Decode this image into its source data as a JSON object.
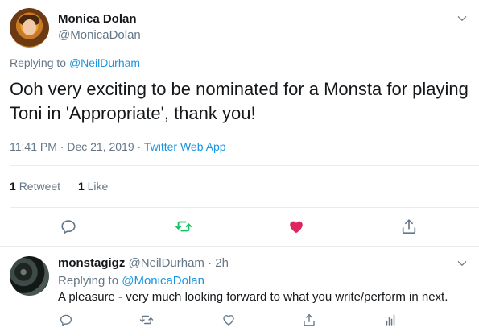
{
  "main_tweet": {
    "author_name": "Monica Dolan",
    "author_handle": "@MonicaDolan",
    "replying_prefix": "Replying to",
    "replying_to": "@NeilDurham",
    "text": "Ooh very exciting to be nominated for a Monsta for playing Toni in 'Appropriate', thank you!",
    "time": "11:41 PM",
    "date": "Dec 21, 2019",
    "dot": "·",
    "source": "Twitter Web App",
    "retweet_count": "1",
    "retweet_label": "Retweet",
    "like_count": "1",
    "like_label": "Like"
  },
  "reply_tweet": {
    "author_name": "monstagigz",
    "author_handle": "@NeilDurham",
    "age": "· 2h",
    "replying_prefix": "Replying to",
    "replying_to": "@MonicaDolan",
    "text": "A pleasure - very much looking forward to what you write/perform in next."
  },
  "colors": {
    "text": "#14171a",
    "secondary": "#657786",
    "link": "#1b95e0",
    "retweet_green": "#17bf63",
    "like_red": "#e0245e"
  },
  "icons": [
    "chevron-down-icon",
    "reply-icon",
    "retweet-icon",
    "heart-icon",
    "share-icon",
    "analytics-icon"
  ]
}
